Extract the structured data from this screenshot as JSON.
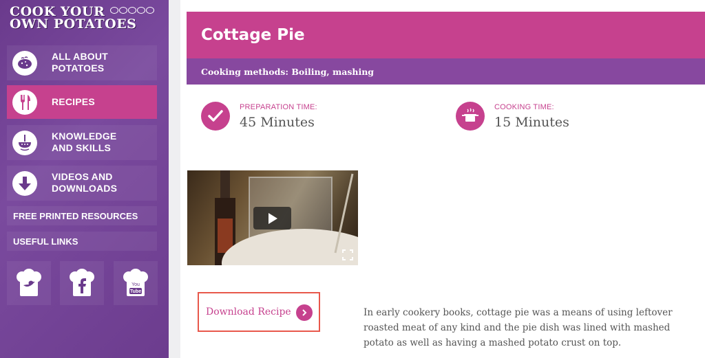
{
  "sidebar": {
    "logo_line1": "COOK YOUR",
    "logo_line2": "OWN POTATOES",
    "nav": [
      {
        "label_line1": "ALL ABOUT",
        "label_line2": "POTATOES",
        "icon": "potato-icon"
      },
      {
        "label_line1": "RECIPES",
        "label_line2": "",
        "icon": "cutlery-icon"
      },
      {
        "label_line1": "KNOWLEDGE",
        "label_line2": "AND SKILLS",
        "icon": "masher-icon"
      },
      {
        "label_line1": "VIDEOS AND",
        "label_line2": "DOWNLOADS",
        "icon": "download-arrow-icon"
      }
    ],
    "links": [
      "FREE PRINTED RESOURCES",
      "USEFUL LINKS"
    ],
    "social": [
      "twitter-icon",
      "facebook-icon",
      "youtube-icon"
    ],
    "youtube_you": "You",
    "youtube_tube": "Tube"
  },
  "recipe": {
    "title": "Cottage Pie",
    "cooking_methods": "Cooking methods: Boiling, mashing",
    "prep_label": "PREPARATION TIME:",
    "prep_value": "45 Minutes",
    "cook_label": "COOKING TIME:",
    "cook_value": "15 Minutes",
    "download_label": "Download Recipe",
    "description": "In early cookery books, cottage pie was a means of using leftover roasted meat of any kind and the pie dish was lined with mashed potato as well as having a mashed potato crust on top."
  },
  "colors": {
    "sidebar": "#6a3a8c",
    "accent_pink": "#c6418e",
    "accent_purple": "#87489f",
    "highlight_border": "#e8574a"
  }
}
